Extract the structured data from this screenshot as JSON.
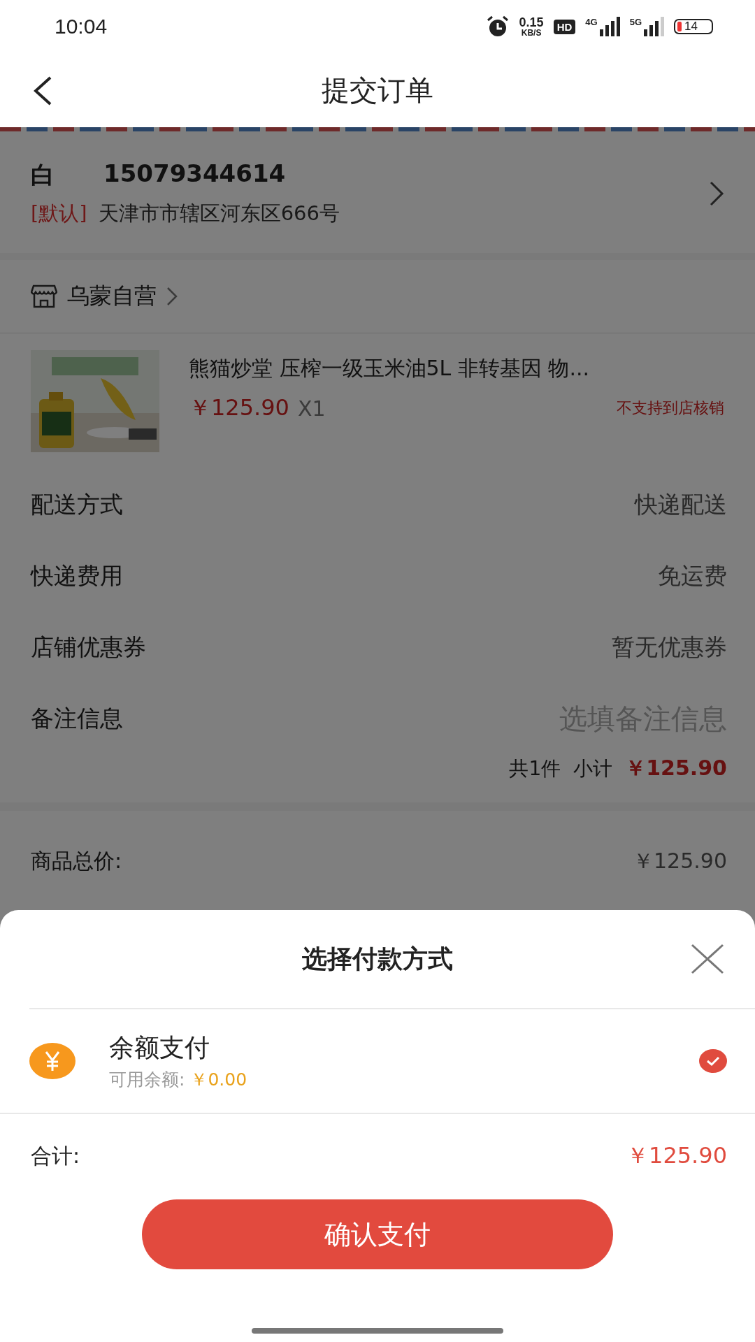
{
  "status_bar": {
    "time": "10:04",
    "speed_value": "0.15",
    "speed_unit": "KB/S",
    "hd": "HD",
    "network_1": "4G",
    "network_2": "5G",
    "battery": "14"
  },
  "header": {
    "title": "提交订单"
  },
  "address": {
    "name": "白",
    "phone": "15079344614",
    "tag": "[默认]",
    "detail": "天津市市辖区河东区666号"
  },
  "store": {
    "name": "乌蒙自营"
  },
  "product": {
    "kind": "picture",
    "title": "熊猫炒堂 压榨一级玉米油5L 非转基因 物...",
    "price": "￥125.90",
    "quantity": "X1",
    "notice": "不支持到店核销"
  },
  "order_rows": [
    {
      "label": "配送方式",
      "value": "快递配送",
      "kind": "value"
    },
    {
      "label": "快递费用",
      "value": "免运费",
      "kind": "value"
    },
    {
      "label": "店铺优惠券",
      "value": "暂无优惠券",
      "kind": "value"
    },
    {
      "label": "备注信息",
      "placeholder": "选填备注信息",
      "kind": "input"
    }
  ],
  "subtotal": {
    "count": "共1件",
    "label": "小计",
    "amount": "￥125.90"
  },
  "summary_rows": [
    {
      "label": "商品总价:",
      "value": "￥125.90"
    }
  ],
  "payment_sheet": {
    "title": "选择付款方式",
    "methods": [
      {
        "name": "余额支付",
        "balance_label": "可用余额:",
        "balance": "￥0.00",
        "selected": true
      }
    ],
    "total_label": "合计:",
    "total": "￥125.90",
    "confirm": "确认支付"
  }
}
